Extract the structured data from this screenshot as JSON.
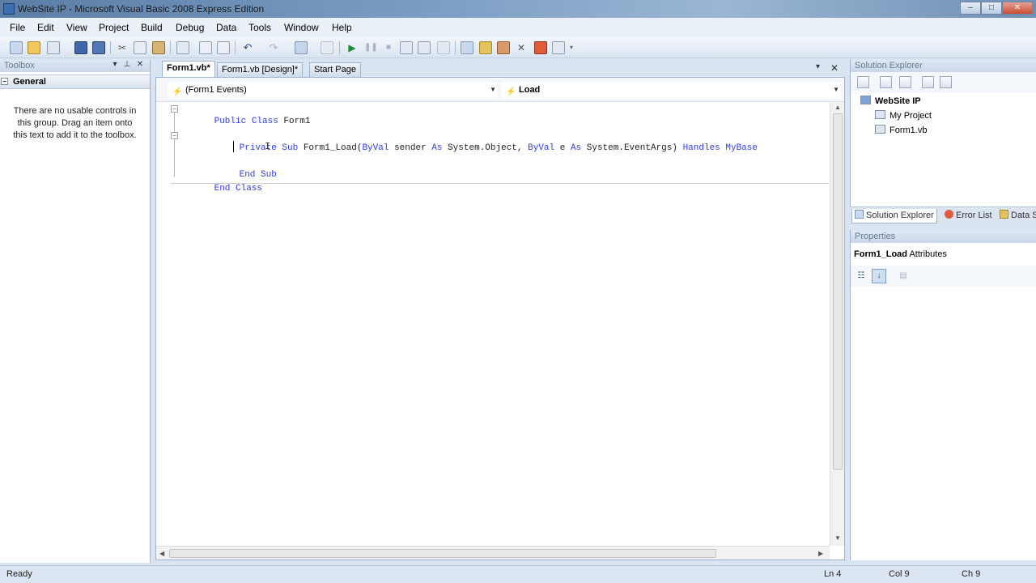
{
  "window": {
    "title": "WebSite IP - Microsoft Visual Basic 2008 Express Edition"
  },
  "menu": [
    "File",
    "Edit",
    "View",
    "Project",
    "Build",
    "Debug",
    "Data",
    "Tools",
    "Window",
    "Help"
  ],
  "toolbox": {
    "header": "Toolbox",
    "group": "General",
    "empty_message": "There are no usable controls in this group. Drag an item onto this text to add it to the toolbox."
  },
  "tabs": [
    {
      "label": "Form1.vb*",
      "active": true
    },
    {
      "label": "Form1.vb [Design]*",
      "active": false
    },
    {
      "label": "Start Page",
      "active": false
    }
  ],
  "editor": {
    "class_combo": "(Form1 Events)",
    "method_combo": "Load",
    "code": {
      "line1_kw": "Public Class",
      "line1_name": " Form1",
      "line2_kw1": "Private Sub",
      "line2_name": " Form1_Load(",
      "line2_kw2": "ByVal",
      "line2_mid1": " sender ",
      "line2_kw3": "As",
      "line2_mid2": " System.Object, ",
      "line2_kw4": "ByVal",
      "line2_mid3": " e ",
      "line2_kw5": "As",
      "line2_mid4": " System.EventArgs) ",
      "line2_kw6": "Handles MyBase",
      "line4_kw": "End Sub",
      "line5_kw": "End Class"
    }
  },
  "solution_explorer": {
    "header": "Solution Explorer",
    "items": [
      "WebSite IP",
      "My Project",
      "Form1.vb"
    ]
  },
  "panel_tabs": [
    "Solution Explorer",
    "Error List",
    "Data S"
  ],
  "properties": {
    "header": "Properties",
    "object_name": "Form1_Load",
    "object_type": "Attributes"
  },
  "status": {
    "ready": "Ready",
    "ln": "Ln 4",
    "col": "Col 9",
    "ch": "Ch 9"
  },
  "icons": {
    "window_controls": [
      "minimize-icon",
      "maximize-icon",
      "close-icon"
    ],
    "caret": "text-cursor-icon"
  },
  "colors": {
    "keyword": "#2f3cf0",
    "panel_bg": "#dbe5f1"
  }
}
